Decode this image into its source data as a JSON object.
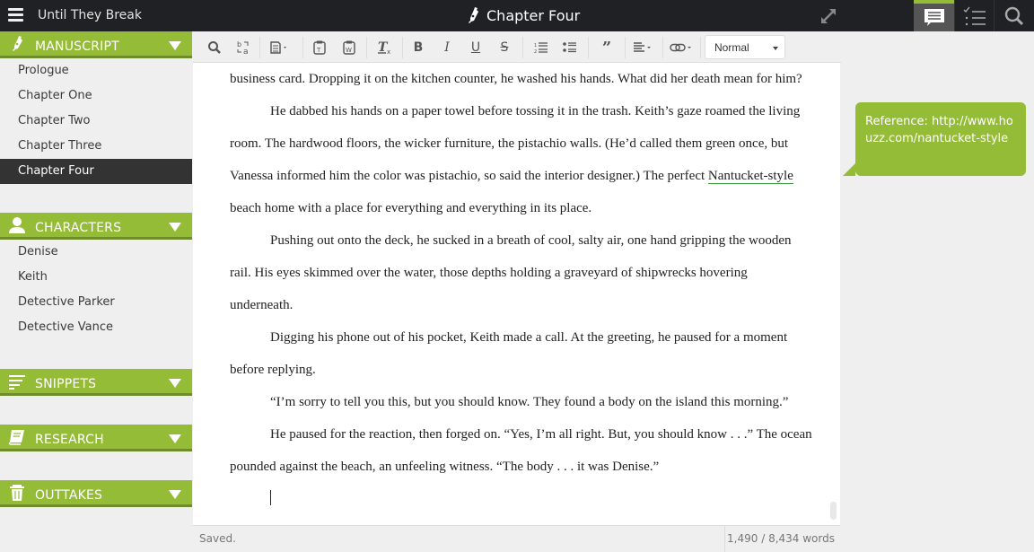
{
  "app": {
    "book_title": "Until They Break",
    "document_title": "Chapter Four"
  },
  "top_tabs": [
    {
      "name": "comments",
      "icon": "comment-icon",
      "active": true
    },
    {
      "name": "checklist",
      "icon": "checklist-icon",
      "active": false
    },
    {
      "name": "search",
      "icon": "search-icon",
      "active": false
    }
  ],
  "sidebar": {
    "manuscript": {
      "label": "MANUSCRIPT",
      "icon": "pen-nib-icon",
      "items": [
        "Prologue",
        "Chapter One",
        "Chapter Two",
        "Chapter Three",
        "Chapter Four"
      ],
      "active": "Chapter Four"
    },
    "characters": {
      "label": "CHARACTERS",
      "icon": "person-icon",
      "items": [
        "Denise",
        "Keith",
        "Detective Parker",
        "Detective Vance"
      ]
    },
    "snippets": {
      "label": "SNIPPETS",
      "icon": "lines-icon"
    },
    "research": {
      "label": "RESEARCH",
      "icon": "book-icon"
    },
    "outtakes": {
      "label": "OUTTAKES",
      "icon": "trash-icon"
    }
  },
  "toolbar": {
    "buttons": [
      "find",
      "find-replace",
      "format-painter",
      "paste-text",
      "paste-word",
      "clear-format",
      "bold",
      "italic",
      "underline",
      "strikethrough",
      "ordered-list",
      "bullet-list",
      "blockquote",
      "align",
      "link"
    ],
    "bold_glyph": "B",
    "italic_glyph": "I",
    "underline_glyph": "U",
    "strike_glyph": "S",
    "quote_glyph": "99",
    "format_select": "Normal"
  },
  "editor": {
    "paragraphs": [
      {
        "indent": false,
        "text": "business card. Dropping it on the kitchen counter, he washed his hands. What did her death mean for him?"
      },
      {
        "indent": true,
        "text_before": "He dabbed his hands on a paper towel before tossing it in the trash. Keith’s gaze roamed the living room. The hardwood floors, the wicker furniture, the pistachio walls. (He’d called them green once, but Vanessa informed him the color was pistachio, so said the interior designer.) The perfect ",
        "link_text": "Nantucket-style",
        "text_after": " beach home with a place for everything and everything in its place."
      },
      {
        "indent": true,
        "text": "Pushing out onto the deck, he sucked in a breath of cool, salty air, one hand gripping the wooden rail. His eyes skimmed over the water, those depths holding a graveyard of shipwrecks hovering underneath."
      },
      {
        "indent": true,
        "text": "Digging his phone out of his pocket, Keith made a call. At the greeting, he paused for a moment before replying."
      },
      {
        "indent": true,
        "text": "“I’m sorry to tell you this, but you should know. They found a body on the island this morning.”"
      },
      {
        "indent": true,
        "text": "He paused for the reaction, then forged on. “Yes, I’m all right. But, you should know . . .” The ocean pounded against the beach, an unfeeling witness. “The body . . . it was Denise.”"
      }
    ]
  },
  "comment": {
    "text": "Reference: http://www.houzz.com/nantucket-style"
  },
  "status": {
    "saved": "Saved.",
    "word_count": "1,490 / 8,434 words"
  },
  "colors": {
    "accent": "#95bc36",
    "topbar": "#1f2124",
    "active_item": "#333333"
  }
}
